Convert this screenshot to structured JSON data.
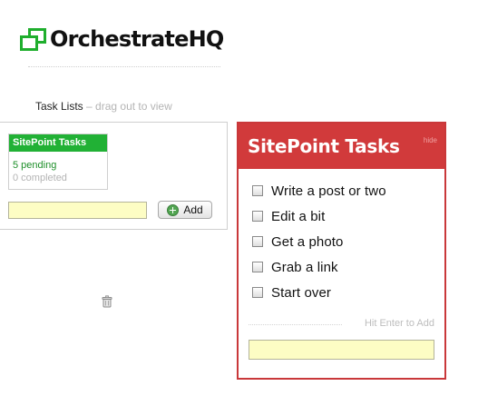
{
  "app": {
    "logo_text": "OrchestrateHQ"
  },
  "lists_section": {
    "heading": "Task Lists",
    "hint": "– drag out to view",
    "new_list_value": "",
    "add_label": "Add"
  },
  "lists": [
    {
      "title": "SitePoint Tasks",
      "pending": "5 pending",
      "completed": "0 completed"
    }
  ],
  "active_list": {
    "title": "SitePoint Tasks",
    "hide_label": "hide",
    "tasks": [
      {
        "label": "Write a post or two",
        "done": false
      },
      {
        "label": "Edit a bit",
        "done": false
      },
      {
        "label": "Get a photo",
        "done": false
      },
      {
        "label": "Grab a link",
        "done": false
      },
      {
        "label": "Start over",
        "done": false
      }
    ],
    "enter_hint": "Hit Enter to Add",
    "new_task_value": ""
  },
  "icons": {
    "add": "add-icon",
    "trash": "trash-icon",
    "logo": "logo-icon"
  },
  "colors": {
    "brand_green": "#1fae2d",
    "list_header_green": "#21b135",
    "panel_red": "#d13a3b",
    "input_yellow": "#fdfdc4"
  }
}
